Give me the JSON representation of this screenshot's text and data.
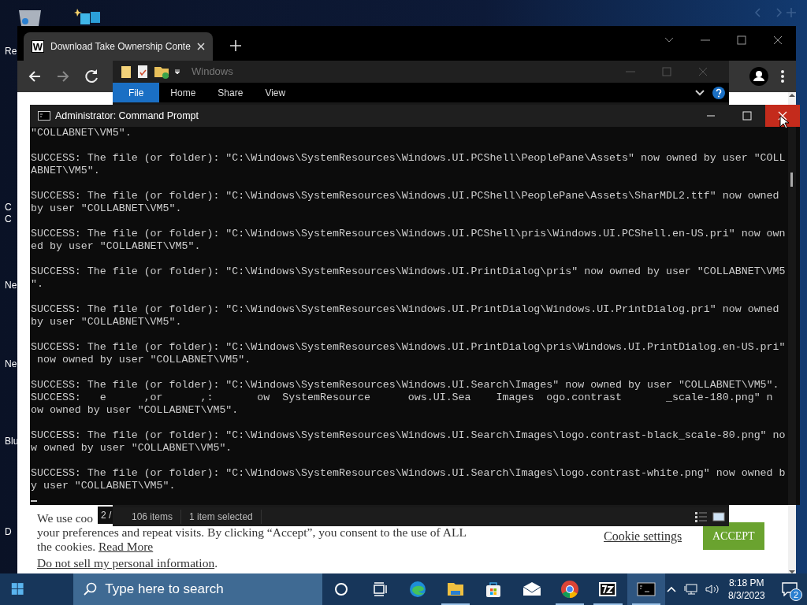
{
  "desktop": {
    "icon_labels": [
      "Re",
      "C",
      "C",
      "Ne",
      "Ne",
      "Blu",
      "D"
    ]
  },
  "browser": {
    "tab": {
      "favicon": "W",
      "title": "Download Take Ownership Conte"
    },
    "page_indicator": "2 /",
    "cookie_banner": {
      "lines": [
        "We use coo",
        "your preferences and repeat visits. By clicking “Accept”, you consent to the use of ALL",
        "the cookies. "
      ],
      "read_more": "Read More",
      "do_not_sell": "Do not sell my personal information",
      "do_not_sell_end": ".",
      "cookie_settings": "Cookie settings",
      "accept": "ACCEPT"
    }
  },
  "explorer": {
    "title": "Windows",
    "ribbon_tabs": [
      {
        "label": "File",
        "selected": true
      },
      {
        "label": "Home",
        "selected": false
      },
      {
        "label": "Share",
        "selected": false
      },
      {
        "label": "View",
        "selected": false
      }
    ],
    "status_items": [
      "106 items",
      "1 item selected"
    ]
  },
  "cmd": {
    "title": "Administrator:  Command Prompt",
    "output": [
      [
        "\"COLLABNET\\VM5\"."
      ],
      [
        "SUCCESS: The file (or folder): \"C:\\Windows\\SystemResources\\Windows.UI.PCShell\\PeoplePane\\Assets\" now owned by user \"COLL",
        "ABNET\\VM5\"."
      ],
      [
        "SUCCESS: The file (or folder): \"C:\\Windows\\SystemResources\\Windows.UI.PCShell\\PeoplePane\\Assets\\SharMDL2.ttf\" now owned",
        "by user \"COLLABNET\\VM5\"."
      ],
      [
        "SUCCESS: The file (or folder): \"C:\\Windows\\SystemResources\\Windows.UI.PCShell\\pris\\Windows.UI.PCShell.en-US.pri\" now own",
        "ed by user \"COLLABNET\\VM5\"."
      ],
      [
        "SUCCESS: The file (or folder): \"C:\\Windows\\SystemResources\\Windows.UI.PrintDialog\\pris\" now owned by user \"COLLABNET\\VM5",
        "\"."
      ],
      [
        "SUCCESS: The file (or folder): \"C:\\Windows\\SystemResources\\Windows.UI.PrintDialog\\Windows.UI.PrintDialog.pri\" now owned",
        "by user \"COLLABNET\\VM5\"."
      ],
      [
        "SUCCESS: The file (or folder): \"C:\\Windows\\SystemResources\\Windows.UI.PrintDialog\\pris\\Windows.UI.PrintDialog.en-US.pri\"",
        " now owned by user \"COLLABNET\\VM5\"."
      ],
      [
        "SUCCESS: The file (or folder): \"C:\\Windows\\SystemResources\\Windows.UI.Search\\Images\" now owned by user \"COLLABNET\\VM5\".",
        "SUCCESS:   e      ,or      ,:       ow  SystemResource      ows.UI.Sea    Images  ogo.contrast       _scale-180.png\" n",
        "ow owned by user \"COLLABNET\\VM5\"."
      ],
      [
        "SUCCESS: The file (or folder): \"C:\\Windows\\SystemResources\\Windows.UI.Search\\Images\\logo.contrast-black_scale-80.png\" no",
        "w owned by user \"COLLABNET\\VM5\"."
      ],
      [
        "SUCCESS: The file (or folder): \"C:\\Windows\\SystemResources\\Windows.UI.Search\\Images\\logo.contrast-white.png\" now owned b",
        "y user \"COLLABNET\\VM5\"."
      ]
    ]
  },
  "taskbar": {
    "search_placeholder": "Type here to search",
    "apps": [
      {
        "kind": "cortana",
        "running": false,
        "active": false
      },
      {
        "kind": "taskview",
        "running": false,
        "active": false
      },
      {
        "kind": "edge",
        "running": false,
        "active": false
      },
      {
        "kind": "folder",
        "running": true,
        "active": false
      },
      {
        "kind": "store",
        "running": false,
        "active": false
      },
      {
        "kind": "mail",
        "running": false,
        "active": false
      },
      {
        "kind": "chrome",
        "running": true,
        "active": false
      },
      {
        "kind": "sevenzip",
        "running": true,
        "active": false
      },
      {
        "kind": "console",
        "running": true,
        "active": true
      }
    ],
    "time": "8:18 PM",
    "date": "8/3/2023",
    "notification_count": "2"
  }
}
